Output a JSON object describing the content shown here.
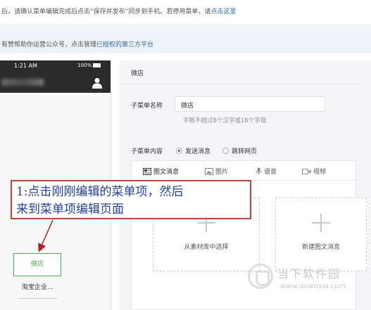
{
  "notices": {
    "top_text": "后，请确认菜单编辑完成后点击“保存并发布”同步到手机。若停用菜单，请",
    "top_link": "点击这里",
    "bar_text": "有赞帮助你运营公众号，点击管理",
    "bar_link": "已授权的第三方平台"
  },
  "phone": {
    "time": "1:21 AM",
    "battery": "100%",
    "menu_items": [
      "微店",
      "淘宝企业..."
    ]
  },
  "editor": {
    "header_title": "微店",
    "name_label": "子菜单名称",
    "name_value": "微店",
    "name_hint": "字数不超过8个汉字或16个字母",
    "content_label": "子菜单内容",
    "radio_send": "发送消息",
    "radio_jump": "跳转网页",
    "tabs": [
      "图文消息",
      "图片",
      "语音",
      "视频"
    ],
    "pick_library": "从素材库中选择",
    "pick_new": "新建图文消息"
  },
  "annotation": {
    "line1": "1:点击刚刚编辑的菜单项，然后",
    "line2": "来到菜单项编辑页面"
  },
  "watermark": {
    "brand": "当下软件园",
    "url": "www.downxia.com"
  }
}
